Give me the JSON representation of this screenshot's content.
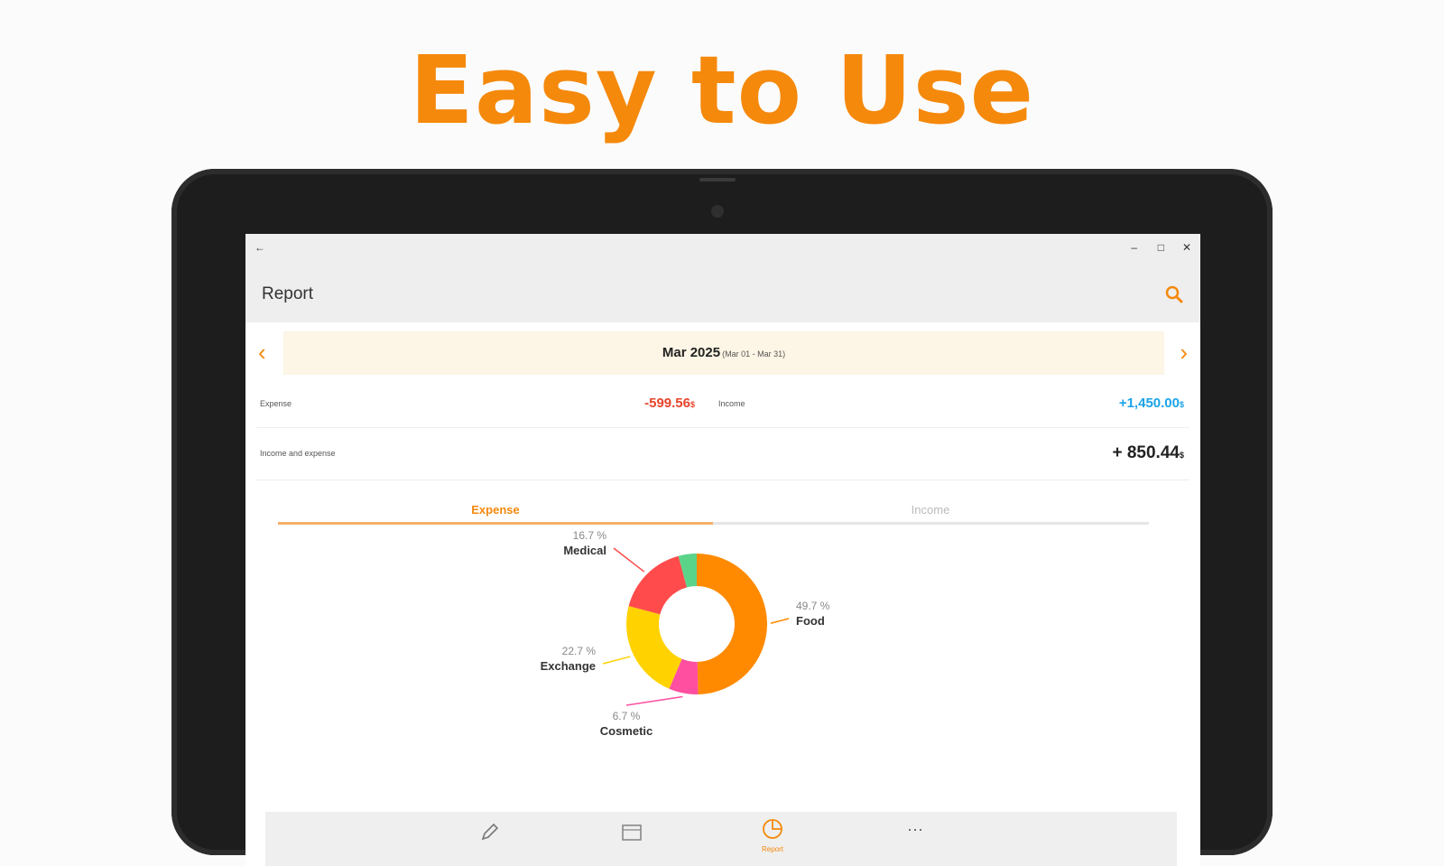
{
  "headline": "Easy to Use",
  "window": {
    "back_icon": "back-arrow-icon",
    "minimize_icon": "minimize-icon",
    "maximize_icon": "maximize-icon",
    "close_icon": "close-icon"
  },
  "appbar": {
    "title": "Report",
    "search_icon": "search-icon"
  },
  "period": {
    "month": "Mar 2025",
    "range": "(Mar 01 - Mar 31)"
  },
  "summary": {
    "expense_label": "Expense",
    "expense_value": "-599.56",
    "income_label": "Income",
    "income_value": "+1,450.00",
    "net_label": "Income and expense",
    "net_value": "+ 850.44",
    "currency": "$"
  },
  "tabs": [
    "Expense",
    "Income"
  ],
  "chart_data": {
    "type": "pie",
    "donut": true,
    "slices": [
      {
        "label": "Food",
        "value": 49.7,
        "color": "#ff8a00"
      },
      {
        "label": "Cosmetic",
        "value": 6.7,
        "color": "#ff4fa0"
      },
      {
        "label": "Exchange",
        "value": 22.7,
        "color": "#ffd200"
      },
      {
        "label": "Medical",
        "value": 16.7,
        "color": "#ff4b4b"
      },
      {
        "label": "",
        "value": 4.2,
        "color": "#5bd48a"
      }
    ]
  },
  "bottom_nav": [
    {
      "icon": "pencil-icon",
      "label": ""
    },
    {
      "icon": "calendar-icon",
      "label": ""
    },
    {
      "icon": "report-chart-icon",
      "label": "Report"
    },
    {
      "icon": "more-icon",
      "label": ""
    }
  ],
  "colors": {
    "accent": "#f5890c",
    "expense": "#e8452c",
    "income": "#1aa3e8"
  }
}
